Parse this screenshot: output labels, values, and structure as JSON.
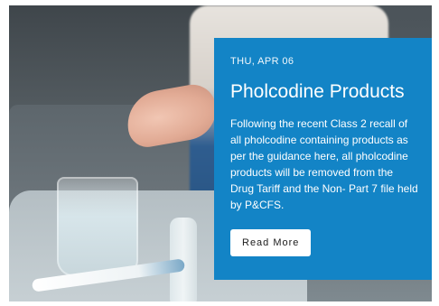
{
  "card": {
    "date": "THU, APR 06",
    "title": "Pholcodine Products",
    "description": "Following the recent Class 2 recall of all pholcodine containing products as per the guidance here, all pholcodine products will be removed from the Drug Tariff and the Non- Part 7 file held by P&CFS.",
    "button_label": "Read More"
  },
  "colors": {
    "panel": "#1384c6",
    "button_bg": "#ffffff",
    "button_text": "#1c1c1c"
  }
}
